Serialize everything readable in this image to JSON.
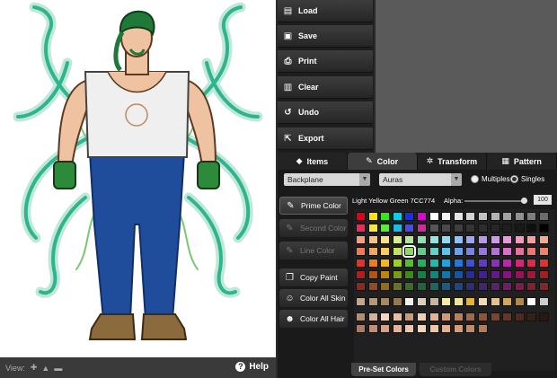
{
  "toolbar": {
    "items": [
      {
        "label": "Load",
        "icon": "folder-icon"
      },
      {
        "label": "Save",
        "icon": "floppy-icon"
      },
      {
        "label": "Print",
        "icon": "printer-icon"
      },
      {
        "label": "Clear",
        "icon": "trash-icon"
      },
      {
        "label": "Undo",
        "icon": "undo-icon"
      },
      {
        "label": "Export",
        "icon": "export-icon"
      }
    ]
  },
  "tabs": [
    {
      "label": "Items",
      "icon": "cube-icon",
      "active": false
    },
    {
      "label": "Color",
      "icon": "brush-icon",
      "active": true
    },
    {
      "label": "Transform",
      "icon": "gear-icon",
      "active": false
    },
    {
      "label": "Pattern",
      "icon": "checker-icon",
      "active": false
    }
  ],
  "controls": {
    "layer_select": "Backplane",
    "item_select": "Auras",
    "multiples_label": "Multiples",
    "singles_label": "Singles",
    "selected_mode": "Singles"
  },
  "left_buttons": [
    {
      "label": "Prime Color",
      "icon": "brush-icon",
      "state": "active"
    },
    {
      "label": "Second Color",
      "icon": "brush-icon",
      "state": "disabled"
    },
    {
      "label": "Line Color",
      "icon": "brush-icon",
      "state": "disabled"
    },
    {
      "label": "Copy Paint",
      "icon": "copy-icon",
      "state": "normal"
    },
    {
      "label": "Color All Skin",
      "icon": "head-icon",
      "state": "normal"
    },
    {
      "label": "Color All Hair",
      "icon": "hair-icon",
      "state": "normal"
    }
  ],
  "color": {
    "name": "Light Yellow Green 7CC774",
    "alpha_label": "Alpha:",
    "alpha_value": "100",
    "alpha_fraction": 1.0,
    "selected_hex": "#7CC774"
  },
  "palette_rows": [
    [
      "#e0001b",
      "#ffe600",
      "#36e51a",
      "#00d0ea",
      "#1c2fe0",
      "#e000d8",
      "#ffffff",
      "#f4f4f4",
      "#e6e6e6",
      "#d4d4d4",
      "#c4c4c4",
      "#b3b3b3",
      "#a3a3a3",
      "#919191",
      "#7e7e7e",
      "#6b6b6b"
    ],
    [
      "#ec2c5a",
      "#ffe838",
      "#5de83e",
      "#1fb9e6",
      "#4b4de2",
      "#d22a9a",
      "#555555",
      "#4a4a4a",
      "#3f3f3f",
      "#353535",
      "#2d2d2d",
      "#262626",
      "#1f1f1f",
      "#181818",
      "#101010",
      "#000000"
    ],
    [
      "#f4a07f",
      "#f8c38a",
      "#f9e08c",
      "#d9ee8f",
      "#b2e59b",
      "#8fdfb1",
      "#8fe6dc",
      "#8fd9f1",
      "#94bff1",
      "#9ea4ef",
      "#b49bea",
      "#ce99e6",
      "#e59ad8",
      "#ef9bbb",
      "#f49e9d",
      "#f4a88c"
    ],
    [
      "#f07a55",
      "#f5a65d",
      "#f6ce5c",
      "#c4e45f",
      "#8fd868",
      "#60ce8a",
      "#5ed5c8",
      "#5cc3ec",
      "#6aa1ea",
      "#7c82e6",
      "#9775e0",
      "#b96fdb",
      "#d871c6",
      "#e6729c",
      "#ed7475",
      "#ef8465"
    ],
    [
      "#e4322a",
      "#ef7a22",
      "#f2b61e",
      "#a2cd25",
      "#56bd2d",
      "#21b25b",
      "#1bbcaa",
      "#1ca4df",
      "#2876d5",
      "#3f4fd1",
      "#6239c6",
      "#8d2fbd",
      "#b62aa8",
      "#d0277a",
      "#de2b4a",
      "#e1322f"
    ],
    [
      "#b21e1b",
      "#b85316",
      "#bb8513",
      "#7a9b18",
      "#3c8c1c",
      "#148242",
      "#10887b",
      "#1077a6",
      "#18559d",
      "#272e99",
      "#431f91",
      "#66188a",
      "#83177a",
      "#961559",
      "#a11736",
      "#a91c1c"
    ],
    [
      "#8a2a22",
      "#8d4d24",
      "#8f6a23",
      "#66722a",
      "#3f6a2b",
      "#24633f",
      "#1f6560",
      "#1f5a7a",
      "#254776",
      "#2e2e73",
      "#3f276e",
      "#562469",
      "#69235d",
      "#742347",
      "#7c2332",
      "#842627"
    ],
    [
      "#c7a48c",
      "#b79878",
      "#a48965",
      "#927a55",
      "#f2f2ed",
      "#dcd1bd",
      "#c7b89d",
      "#f6eea7",
      "#efe49a",
      "#e6b42e",
      "#f2d9b1",
      "#e3c188",
      "#d1a660",
      "#ae8a4d",
      "#ffffff",
      "#cccccc"
    ],
    [
      "#b48c6e",
      "#d6b29a",
      "#f3d5c1",
      "#e7c0a4",
      "#c99a7b",
      "#f1cdb3",
      "#e2b495",
      "#cf9a79",
      "#b98060",
      "#a3684b",
      "#8d5439",
      "#774530",
      "#613828",
      "#4d2b1f",
      "#372016",
      "#2a180f"
    ],
    [
      "#b07a63",
      "#c58d72",
      "#d6a086",
      "#e2b49a",
      "#eec5ad",
      "#f6d3bd",
      "#f0c6a8",
      "#e3b18f",
      "#d39d7a",
      "#c48b68",
      "#b47a5a"
    ]
  ]
}
